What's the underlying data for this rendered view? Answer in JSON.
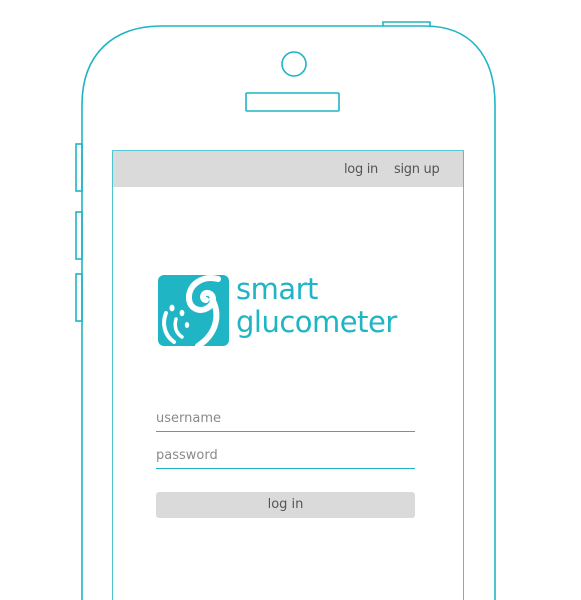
{
  "colors": {
    "accent": "#1fb5c4",
    "topbar_bg": "#dadada",
    "button_bg": "#dadada",
    "text": "#555555"
  },
  "header": {
    "login_link": "log in",
    "signup_link": "sign up"
  },
  "logo": {
    "icon": "smart-glucometer-logo-icon",
    "line1": "smart",
    "line2": "glucometer"
  },
  "form": {
    "username_placeholder": "username",
    "password_placeholder": "password",
    "submit_label": "log in"
  }
}
